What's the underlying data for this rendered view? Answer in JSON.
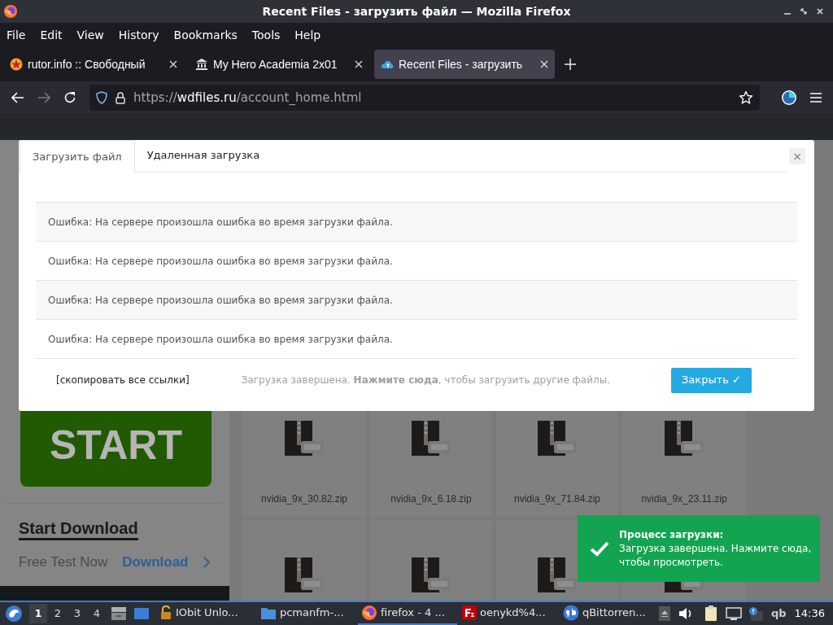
{
  "window": {
    "title": "Recent Files - загрузить файл — Mozilla Firefox"
  },
  "menu": [
    "File",
    "Edit",
    "View",
    "History",
    "Bookmarks",
    "Tools",
    "Help"
  ],
  "tabs": [
    {
      "label": "rutor.info :: Свободный",
      "selected": false,
      "kind": "star"
    },
    {
      "label": "My Hero Academia 2x01",
      "selected": false,
      "kind": "bank"
    },
    {
      "label": "Recent Files - загрузить",
      "selected": true,
      "kind": "cloud"
    }
  ],
  "address": {
    "scheme": "https://",
    "host": "wdfiles.ru",
    "path": "/account_home.html"
  },
  "page": {
    "start_button": "START",
    "heading": "Start Download",
    "free_test": "Free Test Now",
    "download_link": "Download",
    "files": [
      {
        "kind": "zip",
        "name": "nvidia_9x_30.82.zip"
      },
      {
        "kind": "zip",
        "name": "nvidia_9x_6.18.zip"
      },
      {
        "kind": "zip",
        "name": "nvidia_9x_71.84.zip"
      },
      {
        "kind": "zip",
        "name": "nvidia_9x_23.11.zip"
      },
      {
        "kind": "zip"
      },
      {
        "kind": "zip"
      },
      {
        "kind": "zip"
      },
      {
        "kind": "zip"
      }
    ]
  },
  "modal": {
    "tabs": [
      {
        "label": "Загрузить файл",
        "selected": true
      },
      {
        "label": "Удаленная загрузка",
        "selected": false
      }
    ],
    "close": "×",
    "rows": [
      {
        "message": "Ошибка: На сервере произошла ошибка во время загрузки файла."
      },
      {
        "message": "Ошибка: На сервере произошла ошибка во время загрузки файла."
      },
      {
        "message": "Ошибка: На сервере произошла ошибка во время загрузки файла."
      },
      {
        "message": "Ошибка: На сервере произошла ошибка во время загрузки файла."
      }
    ],
    "copy_link": "[скопировать все ссылки]",
    "status": "Загрузка завершена. **Нажмите сюда**, чтобы загрузить другие файлы.",
    "close_button": {
      "label": "Закрыть",
      "icon": "✓"
    }
  },
  "toast": {
    "title": "Процесс загрузки:",
    "message": "Загрузка завершена. Нажмите сюда, чтобы просмотреть."
  },
  "taskbar": {
    "workspaces": [
      {
        "label": "1",
        "selected": true
      },
      {
        "label": "2",
        "selected": false
      },
      {
        "label": "3",
        "selected": false
      },
      {
        "label": "4",
        "selected": false
      }
    ],
    "tasks": [
      {
        "label": "IObit Unlo...",
        "selected": false,
        "kind": "lock"
      },
      {
        "label": "pcmanfm-...",
        "selected": false,
        "kind": "folder"
      },
      {
        "label": "firefox - 4 ...",
        "selected": true,
        "kind": "firefox"
      },
      {
        "label": "oenykd%4...",
        "selected": false,
        "kind": "filezilla"
      },
      {
        "label": "qBittorren...",
        "selected": false,
        "kind": "qbit"
      }
    ],
    "tray_label": "qb",
    "clock": "14:36"
  }
}
